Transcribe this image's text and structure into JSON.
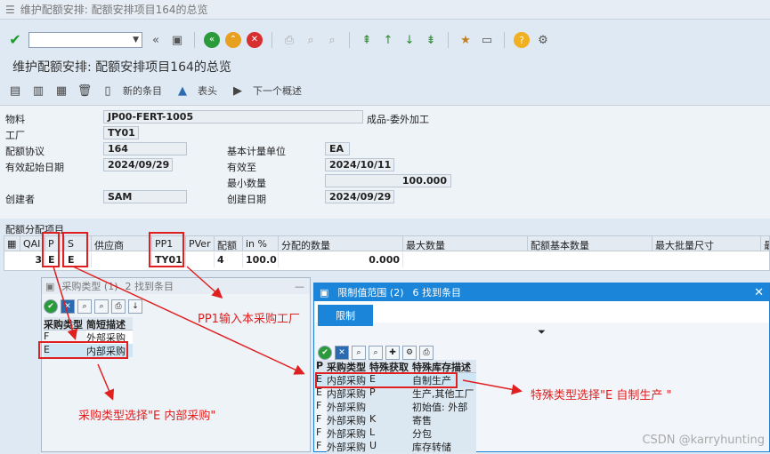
{
  "title": "维护配额安排: 配额安排项目164的总览",
  "heading": "维护配额安排: 配额安排项目164的总览",
  "app_toolbar": {
    "new_items": "新的条目",
    "header": "表头",
    "next_overview": "下一个概述"
  },
  "fields": {
    "material_label": "物料",
    "material_value": "JP00-FERT-1005",
    "material_desc": "成品-委外加工",
    "plant_label": "工厂",
    "plant_value": "TY01",
    "quota_label": "配额协议",
    "quota_value": "164",
    "valid_from_label": "有效起始日期",
    "valid_from_value": "2024/09/29",
    "base_uom_label": "基本计量单位",
    "base_uom_value": "EA",
    "valid_to_label": "有效至",
    "valid_to_value": "2024/10/11",
    "min_qty_label": "最小数量",
    "min_qty_value": "100.000",
    "created_by_label": "创建者",
    "created_by_value": "SAM",
    "created_on_label": "创建日期",
    "created_on_value": "2024/09/29"
  },
  "grid": {
    "section_title": "配额分配项目",
    "headers": [
      "QAI",
      "P",
      "S",
      "供应商",
      "PP1",
      "PVer",
      "配额",
      "in %",
      "分配的数量",
      "最大数量",
      "配额基本数量",
      "最大批量尺寸",
      "最"
    ],
    "row": {
      "qai": "3",
      "p": "E",
      "s": "E",
      "vendor": "",
      "pp1": "TY01",
      "pver": "",
      "quota": "4",
      "pct": "100.0",
      "alloc": "0.000"
    }
  },
  "popup1": {
    "title": "采购类型 (1)",
    "found": "2 找到条目",
    "col1": "采购类型",
    "col2": "简短描述",
    "rows": [
      {
        "code": "F",
        "desc": "外部采购"
      },
      {
        "code": "E",
        "desc": "内部采购"
      }
    ]
  },
  "popup2": {
    "title": "限制值范围 (2)",
    "found": "6 找到条目",
    "tab": "限制",
    "cols": [
      "P",
      "采购类型",
      "特殊获取",
      "特殊库存描述"
    ],
    "rows": [
      {
        "p": "E",
        "type": "内部采购",
        "sp": "E",
        "desc": "自制生产"
      },
      {
        "p": "E",
        "type": "内部采购",
        "sp": "P",
        "desc": "生产,其他工厂"
      },
      {
        "p": "F",
        "type": "外部采购",
        "sp": "",
        "desc": "初始值: 外部"
      },
      {
        "p": "F",
        "type": "外部采购",
        "sp": "K",
        "desc": "寄售"
      },
      {
        "p": "F",
        "type": "外部采购",
        "sp": "L",
        "desc": "分包"
      },
      {
        "p": "F",
        "type": "外部采购",
        "sp": "U",
        "desc": "库存转储"
      }
    ]
  },
  "annotations": {
    "pp1": "PP1输入本采购工厂",
    "ptype": "采购类型选择\"E 内部采购\"",
    "special": "特殊类型选择\"E 自制生产 \""
  },
  "watermark": "CSDN @karryhunting"
}
